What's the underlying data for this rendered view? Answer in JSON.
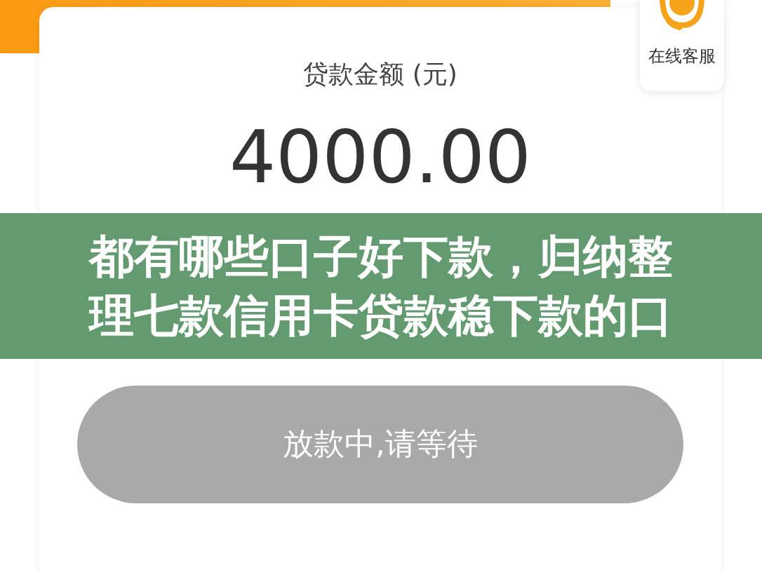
{
  "service": {
    "label": "在线客服"
  },
  "loan": {
    "label": "贷款金额 (元)",
    "amount": "4000.00"
  },
  "banner": {
    "title": "都有哪些口子好下款，归纳整理七款信用卡贷款稳下款的口"
  },
  "submit_button": {
    "label": "放款中,请等待",
    "disabled": true
  }
}
